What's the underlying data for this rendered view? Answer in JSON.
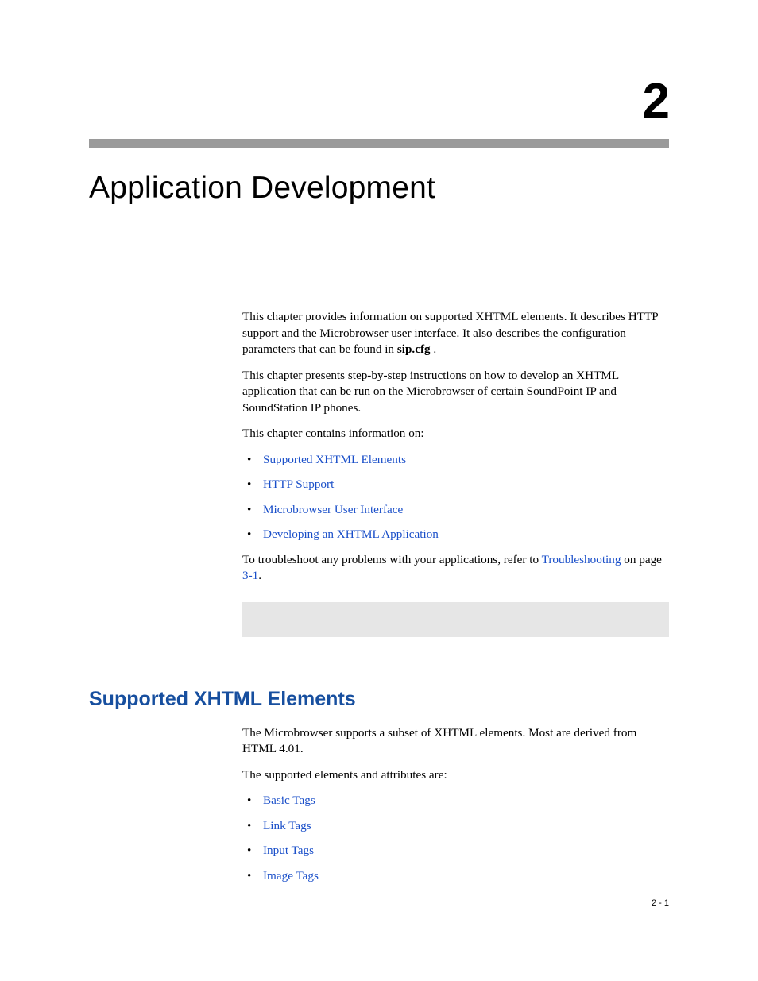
{
  "chapter": {
    "number": "2",
    "title": "Application Development"
  },
  "intro": {
    "p1_pre": "This chapter provides information on supported XHTML elements. It describes HTTP support and the Microbrowser user interface. It also describes the configuration parameters that can be found in ",
    "p1_bold": "sip.cfg",
    "p1_post": " .",
    "p2": "This chapter presents step-by-step instructions on how to develop an XHTML application that can be run on the Microbrowser of certain SoundPoint IP and SoundStation IP phones.",
    "p3": "This chapter contains information on:",
    "bullets": {
      "b1": "Supported XHTML Elements",
      "b2": "HTTP Support",
      "b3": "Microbrowser User Interface",
      "b4": "Developing an XHTML Application"
    },
    "p4_pre": "To troubleshoot any problems with your applications, refer to ",
    "p4_link": "Troubleshooting",
    "p4_mid": " on page ",
    "p4_page": "3-1",
    "p4_post": "."
  },
  "section": {
    "heading": "Supported XHTML Elements",
    "p1": "The Microbrowser supports a subset of XHTML elements. Most are derived from HTML 4.01.",
    "p2": "The supported elements and attributes are:",
    "bullets": {
      "b1": "Basic Tags",
      "b2": "Link Tags",
      "b3": "Input Tags",
      "b4": "Image Tags"
    }
  },
  "pageNumber": "2 - 1"
}
